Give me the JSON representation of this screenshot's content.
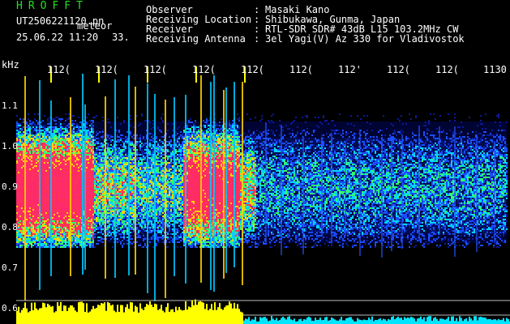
{
  "header": {
    "app_title": "HROFFT",
    "filename": "UT2506221120.pn",
    "tag": "meteor",
    "datetime": "25.06.22 11:20",
    "seconds": "33."
  },
  "info": {
    "observer_label": "Observer",
    "observer_value": "Masaki Kano",
    "location_label": "Receiving Location",
    "location_value": "Shibukawa, Gunma, Japan",
    "receiver_label": "Receiver",
    "receiver_value": "RTL-SDR SDR# 43dB L15 103.2MHz CW",
    "antenna_label": "Receiving Antenna",
    "antenna_value": "3el Yagi(V) Az 330 for Vladivostok",
    "separator": ":"
  },
  "axes": {
    "y_unit": "kHz",
    "y_ticks": [
      "1.1",
      "1.0",
      "0.9",
      "0.8",
      "0.7",
      "0.6"
    ],
    "x_ticks": [
      "112(",
      "112(",
      "112(",
      "112(",
      "112(",
      "112(",
      "112'",
      "112(",
      "112(",
      "1130"
    ]
  },
  "colors": {
    "background": "#000000",
    "title_green": "#1fe31f",
    "text": "#ffffff",
    "marker_yellow": "#ffff00",
    "power_yellow": "#ffff00",
    "power_cyan": "#00e5ff"
  }
}
